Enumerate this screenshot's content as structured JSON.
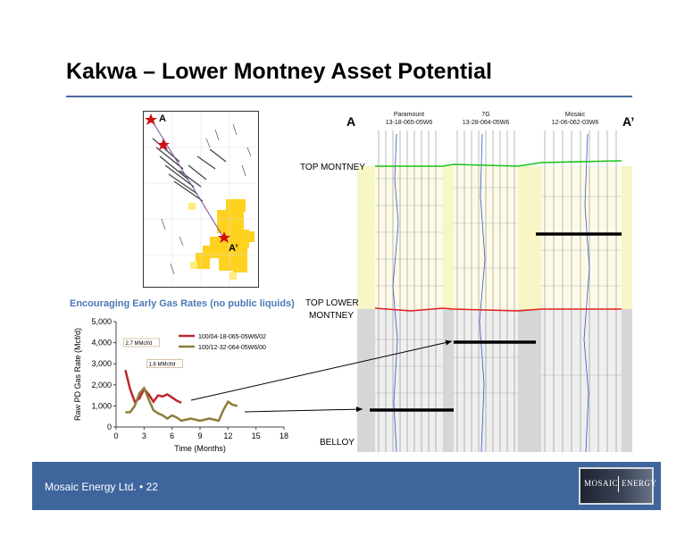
{
  "slide": {
    "title": "Kakwa – Lower Montney Asset Potential",
    "footer_text": "Mosaic Energy Ltd. • 22",
    "logo": {
      "left_text": "MOSAIC",
      "right_text": "ENERGY"
    }
  },
  "map": {
    "point_a": "A",
    "point_a_prime": "A’"
  },
  "cross_section": {
    "label_a": "A",
    "label_a_prime": "A’",
    "wells": [
      {
        "operator": "Paramount",
        "location": "13-18-065-05W6"
      },
      {
        "operator": "7G",
        "location": "13-28-064-05W6"
      },
      {
        "operator": "Mosaic",
        "location": "12-06-062-03W6"
      }
    ],
    "top_montney": "TOP MONTNEY",
    "top_lower_montney_1": "TOP LOWER",
    "top_lower_montney_2": "MONTNEY",
    "belloy": "BELLOY",
    "colors": {
      "upper": "#f9f6c6",
      "lower": "#d6d6d6",
      "green_marker": "#19c319",
      "red_marker": "#e02020"
    }
  },
  "chart_title": "Encouraging Early Gas Rates (no public liquids)",
  "chart_data": {
    "type": "line",
    "xlabel": "Time (Months)",
    "ylabel": "Raw PD Gas Rate (Mcf/d)",
    "xlim": [
      0,
      18
    ],
    "ylim": [
      0,
      5000
    ],
    "xticks": [
      "0",
      "3",
      "6",
      "9",
      "12",
      "15",
      "18"
    ],
    "yticks": [
      "0",
      "1,000",
      "2,000",
      "3,000",
      "4,000",
      "5,000"
    ],
    "series": [
      {
        "name": "100/04-18-065-05W6/02",
        "color": "#c0262d",
        "x": [
          1,
          1.5,
          2,
          2.5,
          3,
          3.5,
          4,
          4.5,
          5,
          5.5,
          6,
          6.5,
          7
        ],
        "y": [
          2700,
          1800,
          1200,
          1350,
          1800,
          1550,
          1200,
          1500,
          1450,
          1550,
          1400,
          1250,
          1150
        ]
      },
      {
        "name": "100/12-32-064-05W6/00",
        "color": "#8c7e3a",
        "x": [
          1,
          1.5,
          2,
          2.5,
          3,
          3.5,
          4,
          4.5,
          5,
          5.5,
          6,
          6.5,
          7,
          7.5,
          8,
          8.5,
          9,
          9.5,
          10,
          10.5,
          11,
          11.5,
          12,
          12.5,
          13
        ],
        "y": [
          700,
          700,
          1000,
          1600,
          1850,
          1300,
          800,
          650,
          550,
          400,
          550,
          450,
          300,
          350,
          400,
          350,
          300,
          350,
          400,
          350,
          300,
          800,
          1200,
          1050,
          1000
        ]
      }
    ],
    "annotations": [
      "2.7 MMcf/d",
      "1.6 MMcf/d"
    ]
  }
}
